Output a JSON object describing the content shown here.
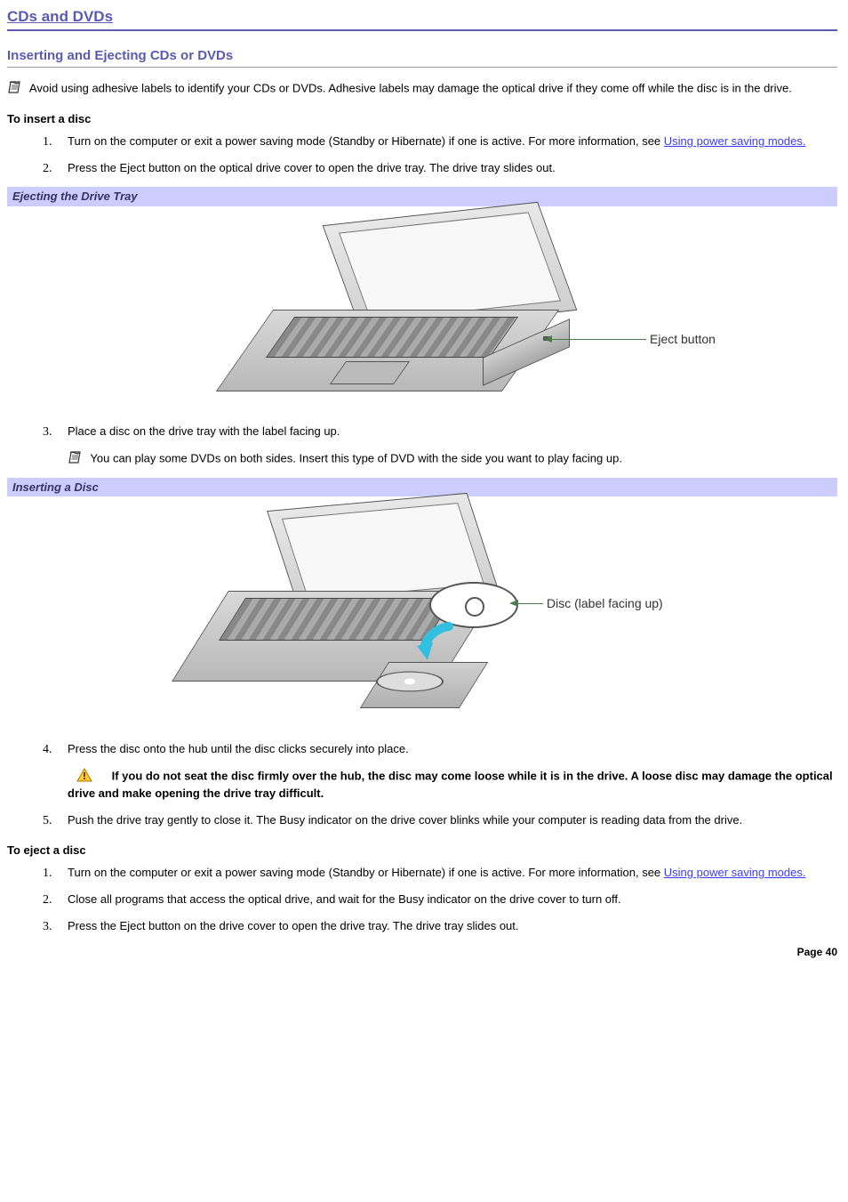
{
  "page_title": "CDs and DVDs",
  "section_title": "Inserting and Ejecting CDs or DVDs",
  "note_adhesive": "Avoid using adhesive labels to identify your CDs or DVDs. Adhesive labels may damage the optical drive if they come off while the disc is in the drive.",
  "insert_heading": "To insert a disc",
  "insert_steps": {
    "s1a": "Turn on the computer or exit a power saving mode (Standby or Hibernate) if one is active. For more information, see ",
    "s1_link": "Using power saving modes.",
    "s2": "Press the Eject button on the optical drive cover to open the drive tray. The drive tray slides out.",
    "s3": "Place a disc on the drive tray with the label facing up.",
    "s3_note": "You can play some DVDs on both sides. Insert this type of DVD with the side you want to play facing up.",
    "s4": "Press the disc onto the hub until the disc clicks securely into place.",
    "s4_warning": "If you do not seat the disc firmly over the hub, the disc may come loose while it is in the drive. A loose disc may damage the optical drive and make opening the drive tray difficult.",
    "s5": "Push the drive tray gently to close it. The Busy indicator on the drive cover blinks while your computer is reading data from the drive."
  },
  "figure1_caption": "Ejecting the Drive Tray",
  "figure1_label": "Eject button",
  "figure2_caption": "Inserting a Disc",
  "figure2_label": "Disc (label facing up)",
  "eject_heading": "To eject a disc",
  "eject_steps": {
    "s1a": "Turn on the computer or exit a power saving mode (Standby or Hibernate) if one is active. For more information, see ",
    "s1_link": "Using power saving modes.",
    "s2": "Close all programs that access the optical drive, and wait for the Busy indicator on the drive cover to turn off.",
    "s3": "Press the Eject button on the drive cover to open the drive tray. The drive tray slides out."
  },
  "page_footer": "Page 40"
}
